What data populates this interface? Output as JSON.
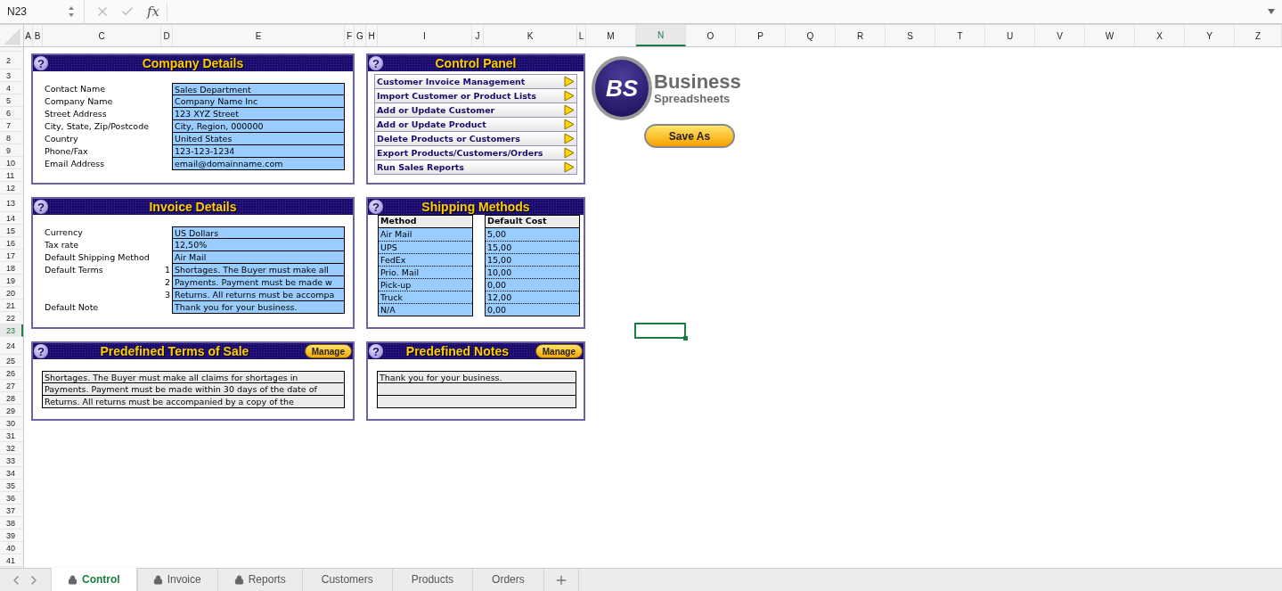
{
  "formula_bar": {
    "name_box": "N23",
    "function_label": "fx"
  },
  "columns": [
    {
      "label": "A",
      "selected": false
    },
    {
      "label": "B",
      "selected": false
    },
    {
      "label": "C",
      "selected": false
    },
    {
      "label": "D",
      "selected": false
    },
    {
      "label": "E",
      "selected": false
    },
    {
      "label": "F",
      "selected": false
    },
    {
      "label": "G",
      "selected": false
    },
    {
      "label": "H",
      "selected": false
    },
    {
      "label": "I",
      "selected": false
    },
    {
      "label": "J",
      "selected": false
    },
    {
      "label": "K",
      "selected": false
    },
    {
      "label": "L",
      "selected": false
    },
    {
      "label": "M",
      "selected": false
    },
    {
      "label": "N",
      "selected": true
    },
    {
      "label": "O",
      "selected": false
    },
    {
      "label": "P",
      "selected": false
    },
    {
      "label": "Q",
      "selected": false
    },
    {
      "label": "R",
      "selected": false
    },
    {
      "label": "S",
      "selected": false
    },
    {
      "label": "T",
      "selected": false
    },
    {
      "label": "U",
      "selected": false
    },
    {
      "label": "V",
      "selected": false
    },
    {
      "label": "W",
      "selected": false
    },
    {
      "label": "X",
      "selected": false
    },
    {
      "label": "Y",
      "selected": false
    },
    {
      "label": "Z",
      "selected": false
    }
  ],
  "rows": [
    {
      "label": "2",
      "selected": false
    },
    {
      "label": "3",
      "selected": false
    },
    {
      "label": "4",
      "selected": false
    },
    {
      "label": "5",
      "selected": false
    },
    {
      "label": "6",
      "selected": false
    },
    {
      "label": "7",
      "selected": false
    },
    {
      "label": "8",
      "selected": false
    },
    {
      "label": "9",
      "selected": false
    },
    {
      "label": "10",
      "selected": false
    },
    {
      "label": "11",
      "selected": false
    },
    {
      "label": "12",
      "selected": false
    },
    {
      "label": "13",
      "selected": false
    },
    {
      "label": "14",
      "selected": false
    },
    {
      "label": "15",
      "selected": false
    },
    {
      "label": "16",
      "selected": false
    },
    {
      "label": "17",
      "selected": false
    },
    {
      "label": "18",
      "selected": false
    },
    {
      "label": "19",
      "selected": false
    },
    {
      "label": "20",
      "selected": false
    },
    {
      "label": "21",
      "selected": false
    },
    {
      "label": "22",
      "selected": false
    },
    {
      "label": "23",
      "selected": true
    },
    {
      "label": "24",
      "selected": false
    },
    {
      "label": "25",
      "selected": false
    },
    {
      "label": "26",
      "selected": false
    },
    {
      "label": "27",
      "selected": false
    },
    {
      "label": "28",
      "selected": false
    },
    {
      "label": "29",
      "selected": false
    },
    {
      "label": "30",
      "selected": false
    },
    {
      "label": "31",
      "selected": false
    },
    {
      "label": "32",
      "selected": false
    },
    {
      "label": "33",
      "selected": false
    },
    {
      "label": "34",
      "selected": false
    },
    {
      "label": "35",
      "selected": false
    },
    {
      "label": "36",
      "selected": false
    },
    {
      "label": "37",
      "selected": false
    },
    {
      "label": "38",
      "selected": false
    },
    {
      "label": "39",
      "selected": false
    },
    {
      "label": "40",
      "selected": false
    },
    {
      "label": "41",
      "selected": false
    }
  ],
  "company_details": {
    "help": "?",
    "title": "Company Details",
    "fields": [
      {
        "label": "Contact Name",
        "value": "Sales Department"
      },
      {
        "label": "Company Name",
        "value": "Company Name Inc"
      },
      {
        "label": "Street Address",
        "value": "123 XYZ Street"
      },
      {
        "label": "City, State, Zip/Postcode",
        "value": "City, Region, 000000"
      },
      {
        "label": "Country",
        "value": "United States"
      },
      {
        "label": "Phone/Fax",
        "value": "123-123-1234"
      },
      {
        "label": "Email Address",
        "value": "email@domainname.com"
      }
    ]
  },
  "control_panel": {
    "help": "?",
    "title": "Control Panel",
    "buttons": [
      "Customer Invoice Management",
      "Import Customer or Product Lists",
      "Add or Update Customer",
      "Add or Update Product",
      "Delete Products or Customers",
      "Export Products/Customers/Orders",
      "Run Sales Reports"
    ]
  },
  "logo": {
    "mark": "BS",
    "name": "Business",
    "tagline": "Spreadsheets"
  },
  "save_button": "Save As",
  "invoice_details": {
    "help": "?",
    "title": "Invoice Details",
    "fields": [
      {
        "label": "Currency",
        "value": "US Dollars"
      },
      {
        "label": "Tax rate",
        "value": "12,50%"
      },
      {
        "label": "Default Shipping Method",
        "value": "Air Mail"
      },
      {
        "label": "Default Terms",
        "number": "1",
        "value": "Shortages. The Buyer must make all"
      },
      {
        "number": "2",
        "value": "Payments. Payment must be made w"
      },
      {
        "number": "3",
        "value": "Returns. All returns must be accompa"
      },
      {
        "label": "Default Note",
        "value": "Thank you for your business."
      }
    ]
  },
  "shipping_methods": {
    "help": "?",
    "title": "Shipping Methods",
    "columns": [
      "Method",
      "Default Cost"
    ],
    "rows": [
      [
        "Air Mail",
        "5,00"
      ],
      [
        "UPS",
        "15,00"
      ],
      [
        "FedEx",
        "15,00"
      ],
      [
        "Prio. Mail",
        "10,00"
      ],
      [
        "Pick-up",
        "0,00"
      ],
      [
        "Truck",
        "12,00"
      ],
      [
        "N/A",
        "0,00"
      ]
    ]
  },
  "predefined_terms": {
    "help": "?",
    "title": "Predefined Terms of Sale",
    "manage": "Manage",
    "items": [
      "Shortages. The Buyer must make all claims for shortages in",
      "Payments. Payment must be made within 30 days of the date of",
      "Returns. All returns must be accompanied by a copy of the"
    ]
  },
  "predefined_notes": {
    "help": "?",
    "title": "Predefined Notes",
    "manage": "Manage",
    "items": [
      "Thank you for your business."
    ]
  },
  "sheet_tabs": [
    {
      "label": "Control",
      "locked": true,
      "selected": true
    },
    {
      "label": "Invoice",
      "locked": true,
      "selected": false
    },
    {
      "label": "Reports",
      "locked": true,
      "selected": false
    },
    {
      "label": "Customers",
      "locked": false,
      "selected": false
    },
    {
      "label": "Products",
      "locked": false,
      "selected": false
    },
    {
      "label": "Orders",
      "locked": false,
      "selected": false
    }
  ]
}
